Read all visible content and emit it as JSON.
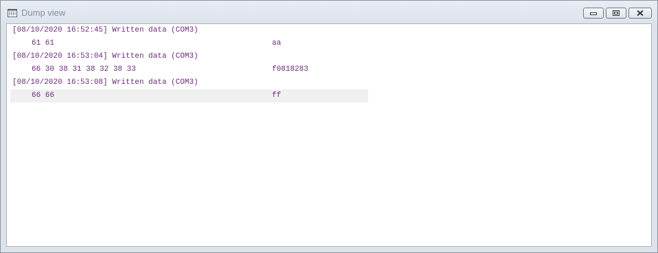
{
  "window": {
    "title": "Dump view",
    "icon": "dump-view-icon",
    "controls": {
      "minimize": "minimize-icon",
      "restore": "restore-icon",
      "close": "close-icon"
    }
  },
  "entries": [
    {
      "header": "[08/10/2020 16:52:45] Written data (COM3)",
      "hex": "61 61",
      "ascii": "aa"
    },
    {
      "header": "[08/10/2020 16:53:04] Written data (COM3)",
      "hex": "66 30 38 31 38 32 38 33",
      "ascii": "f0818283"
    },
    {
      "header": "[08/10/2020 16:53:08] Written data (COM3)",
      "hex": "66 66",
      "ascii": "ff"
    }
  ],
  "colors": {
    "text": "#6b2a7a",
    "selected_row": "#f0f0f0"
  }
}
